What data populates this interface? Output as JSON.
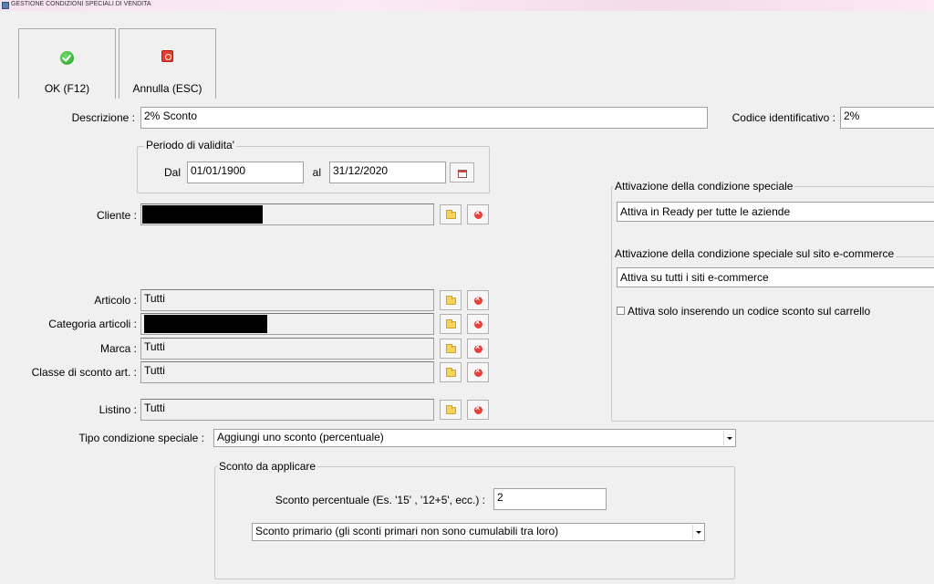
{
  "window": {
    "title": "GESTIONE CONDIZIONI SPECIALI DI VENDITA"
  },
  "toolbar": {
    "ok_label": "OK (F12)",
    "cancel_label": "Annulla (ESC)"
  },
  "form": {
    "descrizione_label": "Descrizione :",
    "descrizione_value": "2% Sconto",
    "codice_label": "Codice identificativo :",
    "codice_value": "2%",
    "periodo": {
      "title": "Periodo di validita'",
      "dal_label": "Dal",
      "dal_value": "01/01/1900",
      "al_label": "al",
      "al_value": "31/12/2020"
    },
    "cliente_label": "Cliente :",
    "articolo_label": "Articolo :",
    "articolo_value": "Tutti",
    "categoria_label": "Categoria articoli :",
    "marca_label": "Marca :",
    "marca_value": "Tutti",
    "classe_label": "Classe di sconto art. :",
    "classe_value": "Tutti",
    "listino_label": "Listino :",
    "listino_value": "Tutti",
    "tipo_label": "Tipo condizione speciale :",
    "tipo_value": "Aggiungi uno sconto (percentuale)"
  },
  "attivazione": {
    "title": "Attivazione della condizione speciale",
    "value": "Attiva in Ready per tutte le aziende",
    "ecommerce_title": "Attivazione della condizione speciale sul sito e-commerce",
    "ecommerce_value": "Attiva su tutti i siti e-commerce",
    "checkbox_label": "Attiva solo inserendo un codice sconto sul carrello",
    "checkbox_checked": false
  },
  "sconto": {
    "title": "Sconto da applicare",
    "percentuale_label": "Sconto percentuale (Es. '15' , '12+5', ecc.) :",
    "percentuale_value": "2",
    "tipo_value": "Sconto primario (gli sconti primari non sono cumulabili tra loro)"
  }
}
